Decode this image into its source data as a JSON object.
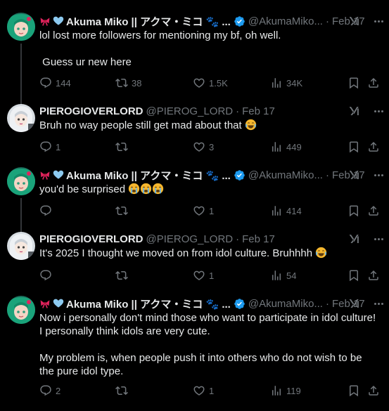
{
  "tweets": [
    {
      "display_name": "Akuma Miko || アクマ・ミコ 🐾 ...",
      "handle": "@AkumaMiko...",
      "date": "Feb 17",
      "text": "lol lost more followers for mentioning my bf, oh well.\n\n Guess ur new here",
      "replies": "144",
      "reposts": "38",
      "likes": "1.5K",
      "views": "34K",
      "verified": true
    },
    {
      "display_name": "PIEROGIOVERLORD",
      "handle": "@PIEROG_LORD",
      "date": "Feb 17",
      "text": "Bruh no way people still get mad about that",
      "replies": "1",
      "reposts": "",
      "likes": "3",
      "views": "449",
      "verified": false
    },
    {
      "display_name": "Akuma Miko || アクマ・ミコ 🐾 ...",
      "handle": "@AkumaMiko...",
      "date": "Feb 17",
      "text": "you'd be surprised",
      "replies": "",
      "reposts": "",
      "likes": "1",
      "views": "414",
      "verified": true
    },
    {
      "display_name": "PIEROGIOVERLORD",
      "handle": "@PIEROG_LORD",
      "date": "Feb 17",
      "text": "It's 2025 I thought we moved on from idol culture. Bruhhhh",
      "replies": "",
      "reposts": "",
      "likes": "1",
      "views": "54",
      "verified": false
    },
    {
      "display_name": "Akuma Miko || アクマ・ミコ 🐾 ...",
      "handle": "@AkumaMiko...",
      "date": "Feb 17",
      "text": "Now i personally don't mind those who want to participate in idol culture! I personally think idols are very cute.\n\nMy problem is, when people push it into others who do not wish to be the pure idol type.",
      "replies": "2",
      "reposts": "",
      "likes": "1",
      "views": "119",
      "verified": true
    }
  ],
  "colors": {
    "background": "#000000",
    "text": "#e7e9ea",
    "muted": "#71767b",
    "verified": "#1d9bf0",
    "thread_line": "#333639"
  },
  "icons": {
    "reply": "speech-bubble-icon",
    "repost": "repost-arrows-icon",
    "like": "heart-icon",
    "views": "bar-chart-icon",
    "bookmark": "bookmark-icon",
    "share": "share-upload-icon",
    "grok": "grok-icon",
    "more": "more-dots-icon"
  }
}
